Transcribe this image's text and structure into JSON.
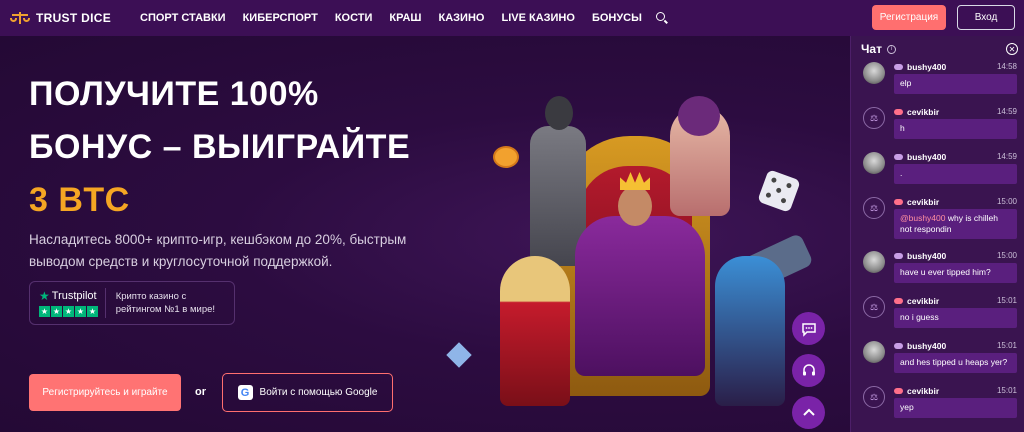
{
  "header": {
    "logo_text": "TRUST DICE",
    "nav": [
      "СПОРТ СТАВКИ",
      "КИБЕРСПОРТ",
      "КОСТИ",
      "КРАШ",
      "КАЗИНО",
      "LIVE КАЗИНО",
      "БОНУСЫ"
    ],
    "register_label": "Регистрация",
    "login_label": "Вход",
    "search_icon": "search-icon"
  },
  "hero": {
    "headline_line1": "ПОЛУЧИТЕ 100%",
    "headline_line2": "БОНУС – ВЫИГРАЙТЕ",
    "headline_accent": "3 BTC",
    "subtext": "Насладитесь 8000+ крипто-игр, кешбэком до 20%, быстрым выводом средств и круглосуточной поддержкой.",
    "trustpilot_brand": "Trustpilot",
    "trustpilot_text": "Крипто казино с рейтингом №1 в мире!",
    "cta_register": "Регистрируйтесь и играйте",
    "or_text": "or",
    "cta_google": "Войти с помощью Google",
    "accent_color": "#f5a623"
  },
  "chat": {
    "title": "Чат",
    "messages": [
      {
        "user": "bushy400",
        "time": "14:58",
        "text": "elp",
        "avatar": "photo"
      },
      {
        "user": "cevikbir",
        "time": "14:59",
        "text": "h",
        "avatar": "logo"
      },
      {
        "user": "bushy400",
        "time": "14:59",
        "text": ".",
        "avatar": "photo"
      },
      {
        "user": "cevikbir",
        "time": "15:00",
        "mention": "@bushy400",
        "text": " why is chilleh not respondin",
        "avatar": "logo"
      },
      {
        "user": "bushy400",
        "time": "15:00",
        "text": "have u ever tipped him?",
        "avatar": "photo"
      },
      {
        "user": "cevikbir",
        "time": "15:01",
        "text": "no i guess",
        "avatar": "logo"
      },
      {
        "user": "bushy400",
        "time": "15:01",
        "text": "and hes tipped u heaps yer?",
        "avatar": "photo"
      },
      {
        "user": "cevikbir",
        "time": "15:01",
        "text": "yep",
        "avatar": "logo"
      }
    ]
  },
  "colors": {
    "header_bg": "#3c0f55",
    "hero_bg": "#2c0c40",
    "chat_bg": "#3a1450",
    "bubble_bg": "#5a1f7e",
    "brand_red": "#ff6f6f"
  }
}
